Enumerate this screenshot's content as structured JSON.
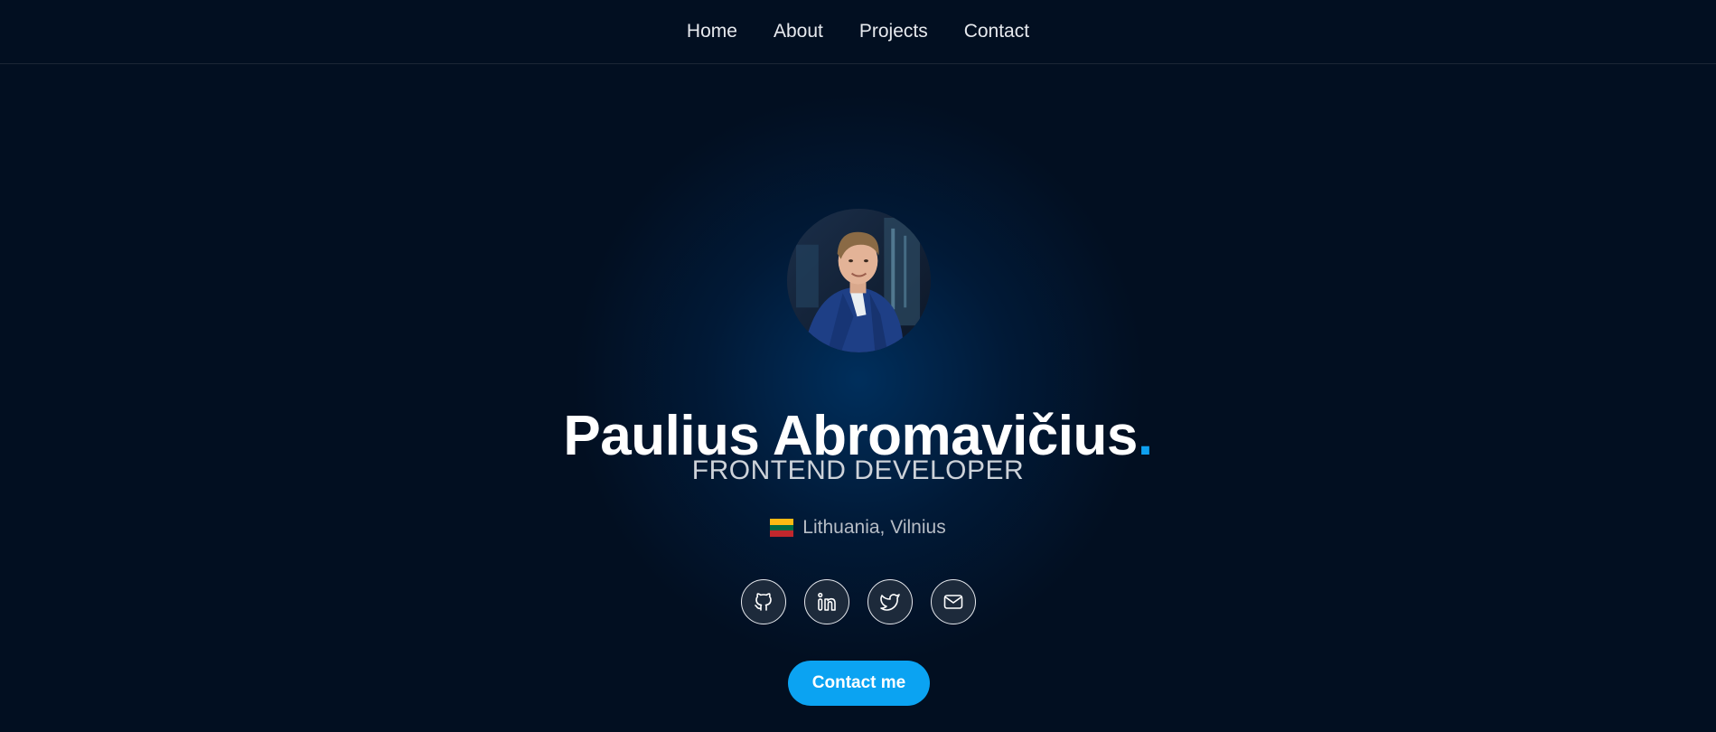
{
  "nav": {
    "items": [
      {
        "label": "Home"
      },
      {
        "label": "About"
      },
      {
        "label": "Projects"
      },
      {
        "label": "Contact"
      }
    ]
  },
  "hero": {
    "name": "Paulius Abromavičius",
    "name_dot": ".",
    "role": "FRONTEND DEVELOPER",
    "location": "Lithuania, Vilnius",
    "flag_colors": [
      "#fdb913",
      "#006a44",
      "#c1272d"
    ],
    "social_icons": [
      "github-icon",
      "linkedin-icon",
      "twitter-icon",
      "mail-icon"
    ],
    "cta_label": "Contact me"
  },
  "colors": {
    "background": "#020f21",
    "accent": "#0ba3f2",
    "text_primary": "#ffffff",
    "text_secondary": "#cdd2d9"
  }
}
